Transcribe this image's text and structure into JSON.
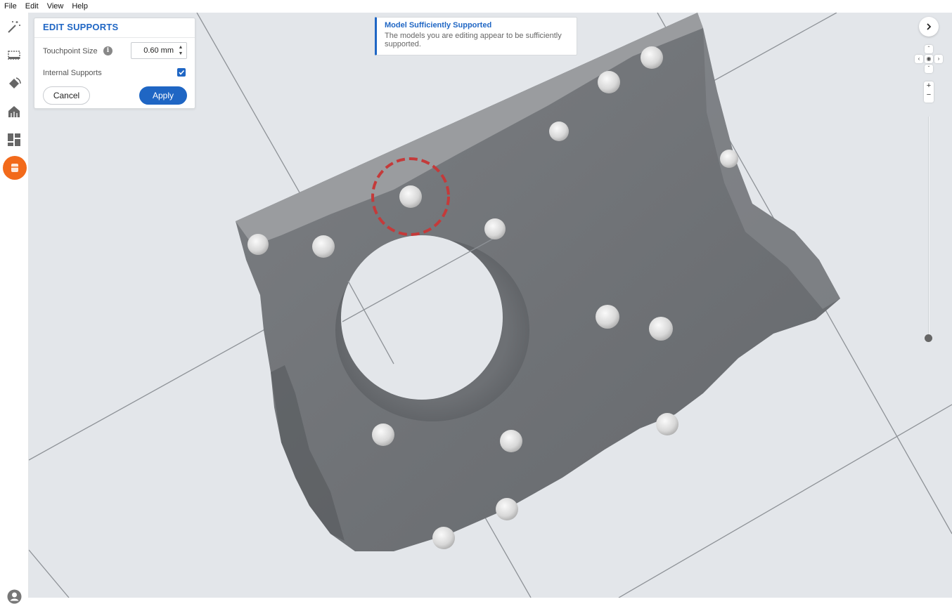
{
  "menu": {
    "file": "File",
    "edit": "Edit",
    "view": "View",
    "help": "Help"
  },
  "toolbar": {
    "tools": [
      "magic-wand-icon",
      "selection-icon",
      "orientation-icon",
      "layout-icon",
      "arrange-icon",
      "supports-icon"
    ],
    "active_tool": "supports-icon",
    "accent_color": "#f26a1b"
  },
  "panel": {
    "title": "EDIT SUPPORTS",
    "touchpoint_label": "Touchpoint Size",
    "touchpoint_value": "0.60 mm",
    "internal_supports_label": "Internal Supports",
    "internal_supports_checked": true,
    "cancel_label": "Cancel",
    "apply_label": "Apply",
    "accent_color": "#1f66c4"
  },
  "notice": {
    "title": "Model Sufficiently Supported",
    "body": "The models you are editing appear to be sufficiently supported."
  },
  "view_controls": {
    "zoom_in": "+",
    "zoom_out": "−"
  }
}
